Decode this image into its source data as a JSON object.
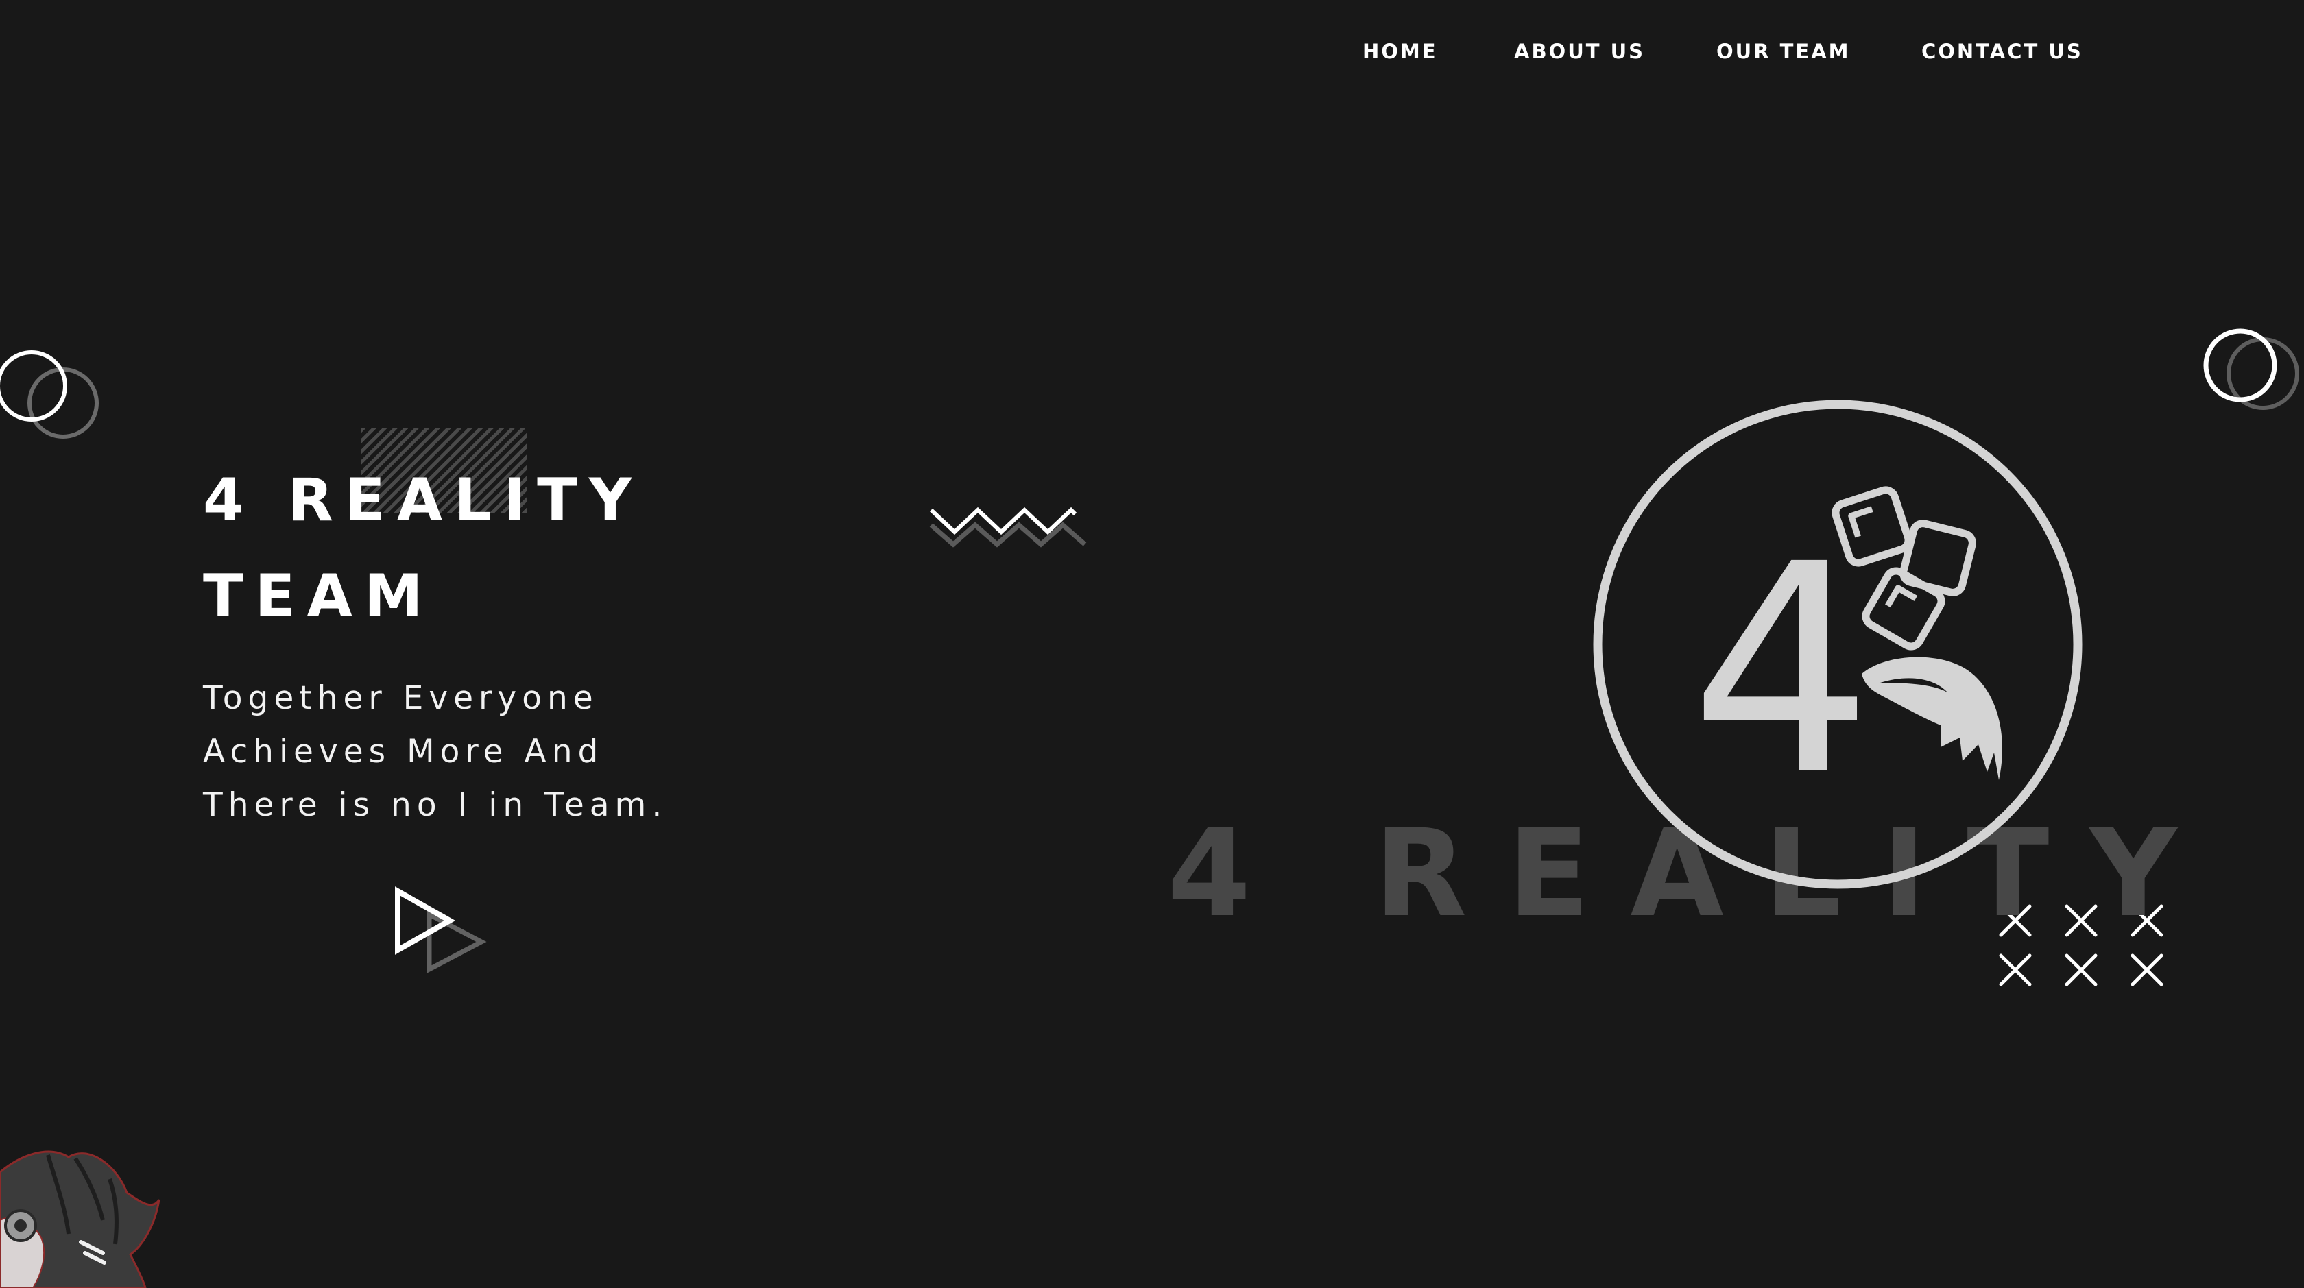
{
  "nav": {
    "items": [
      {
        "label": "HOME"
      },
      {
        "label": "ABOUT US"
      },
      {
        "label": "OUR TEAM"
      },
      {
        "label": "CONTACT US"
      }
    ]
  },
  "hero": {
    "title_line1": "4 REALITY",
    "title_line2": "TEAM",
    "tagline_line1": "Together Everyone",
    "tagline_line2": "Achieves More And",
    "tagline_line3": "There is no I in Team."
  },
  "logo": {
    "mark_text": "4",
    "watermark_text": "4 REALITY"
  },
  "colors": {
    "background": "#181818",
    "text": "#ffffff",
    "logo": "#d4d4d4",
    "muted": "#474747",
    "accent_red": "#8b2a2a"
  }
}
